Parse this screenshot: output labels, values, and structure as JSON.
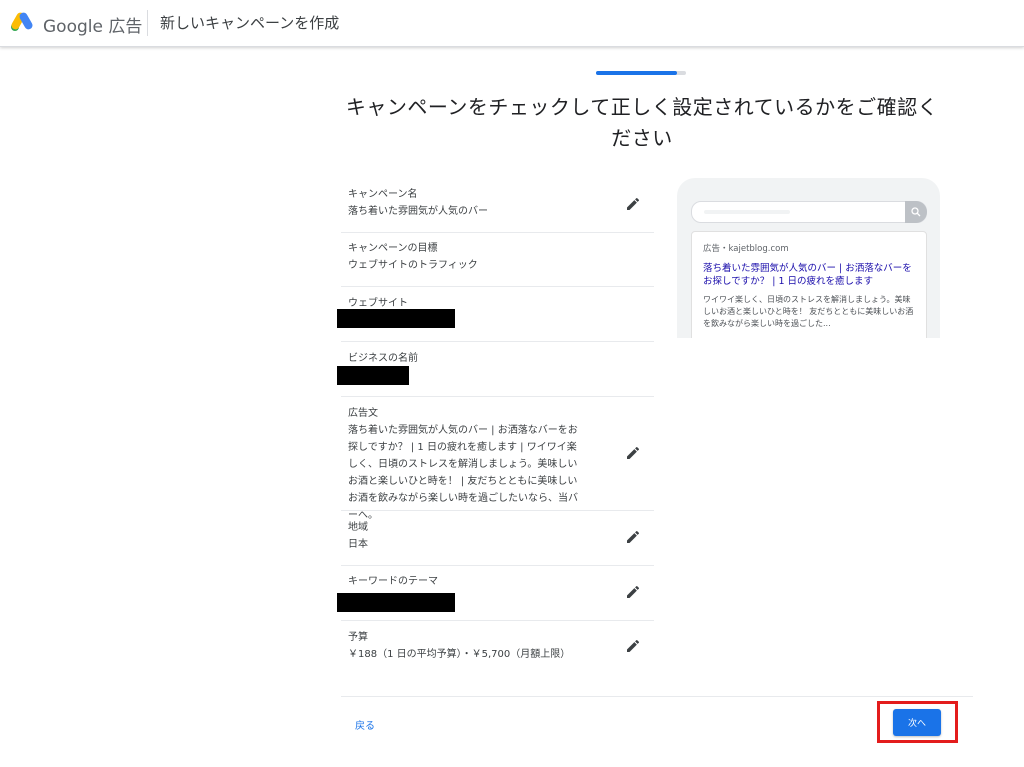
{
  "header": {
    "brand": "Google 広告",
    "page_title": "新しいキャンペーンを作成"
  },
  "progress": {
    "fraction": 0.9
  },
  "main": {
    "title": "キャンペーンをチェックして正しく設定されているかをご確認ください"
  },
  "summary": {
    "campaign_name": {
      "label": "キャンペーン名",
      "value": "落ち着いた雰囲気が人気のバー"
    },
    "campaign_goal": {
      "label": "キャンペーンの目標",
      "value": "ウェブサイトのトラフィック"
    },
    "website": {
      "label": "ウェブサイト",
      "value": ""
    },
    "business_name": {
      "label": "ビジネスの名前",
      "value": ""
    },
    "ad_text": {
      "label": "広告文",
      "value": "落ち着いた雰囲気が人気のバー | お洒落なバーをお探しですか？ | 1 日の疲れを癒します | ワイワイ楽しく、日頃のストレスを解消しましょう。美味しいお酒と楽しいひと時を！ | 友だちとともに美味しいお酒を飲みながら楽しい時を過ごしたいなら、当バーへ。"
    },
    "region": {
      "label": "地域",
      "value": "日本"
    },
    "keyword_theme": {
      "label": "キーワードのテーマ",
      "value": ""
    },
    "budget": {
      "label": "予算",
      "value": "￥188（1 日の平均予算）・￥5,700（月額上限）"
    }
  },
  "preview": {
    "ad_meta": "広告・kajetblog.com",
    "headline": "落ち着いた雰囲気が人気のバー | お洒落なバーをお探しですか？ | 1 日の疲れを癒します",
    "description": "ワイワイ楽しく、日頃のストレスを解消しましょう。美味しいお酒と楽しいひと時を！ 友だちとともに美味しいお酒を飲みながら楽しい時を過ごした..."
  },
  "footer": {
    "back_label": "戻る",
    "next_label": "次へ"
  },
  "colors": {
    "accent": "#1a73e8",
    "highlight_box": "#e31c1c",
    "ad_link": "#1a0dab"
  }
}
